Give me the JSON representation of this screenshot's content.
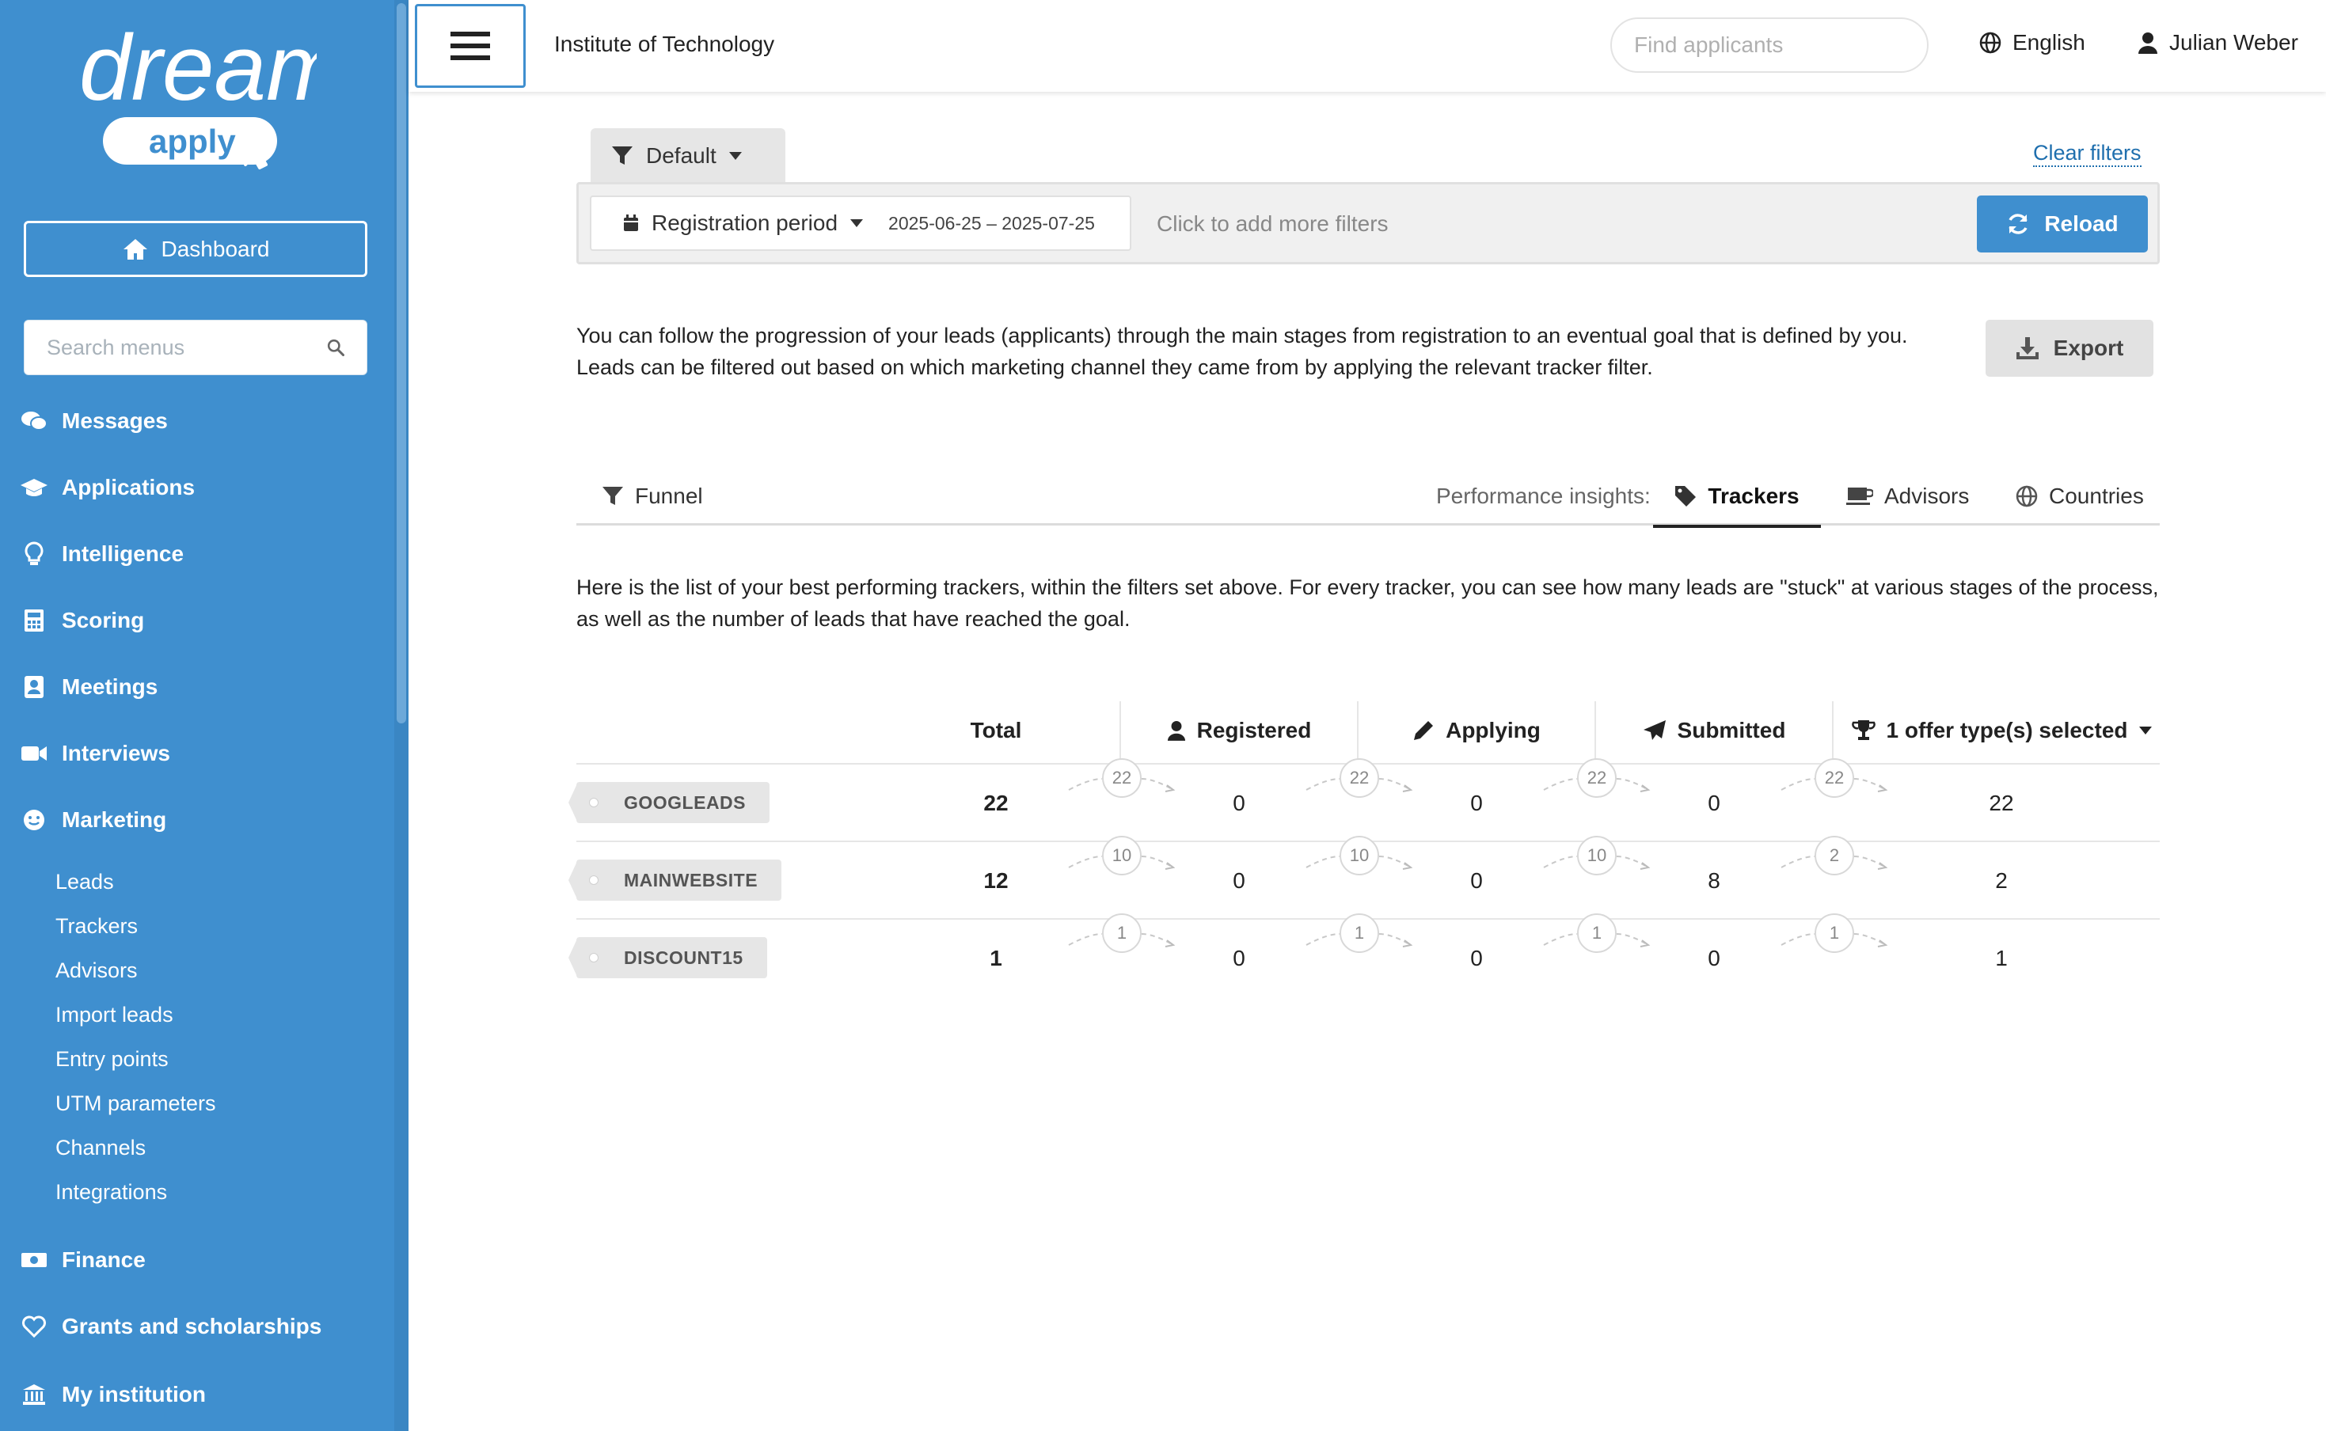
{
  "sidebar": {
    "logo_text": "dream",
    "logo_sub": "apply",
    "dashboard_label": "Dashboard",
    "search_placeholder": "Search menus",
    "items": [
      {
        "label": "Messages",
        "icon": "comments-icon"
      },
      {
        "label": "Applications",
        "icon": "graduation-cap-icon"
      },
      {
        "label": "Intelligence",
        "icon": "lightbulb-icon"
      },
      {
        "label": "Scoring",
        "icon": "calculator-icon"
      },
      {
        "label": "Meetings",
        "icon": "contact-card-icon"
      },
      {
        "label": "Interviews",
        "icon": "video-camera-icon"
      },
      {
        "label": "Marketing",
        "icon": "smile-icon"
      },
      {
        "label": "Finance",
        "icon": "money-icon"
      },
      {
        "label": "Grants and scholarships",
        "icon": "heart-icon"
      },
      {
        "label": "My institution",
        "icon": "institution-icon"
      }
    ],
    "marketing_sub": [
      "Leads",
      "Trackers",
      "Advisors",
      "Import leads",
      "Entry points",
      "UTM parameters",
      "Channels",
      "Integrations"
    ]
  },
  "topbar": {
    "institution": "Institute of Technology",
    "search_placeholder": "Find applicants",
    "language": "English",
    "user": "Julian Weber"
  },
  "filters": {
    "preset": "Default",
    "clear_label": "Clear filters",
    "period_label": "Registration period",
    "period_dates": "2025-06-25 – 2025-07-25",
    "add_more": "Click to add more filters",
    "reload_label": "Reload"
  },
  "intro": {
    "text": "You can follow the progression of your leads (applicants) through the main stages from registration to an eventual goal that is defined by you. Leads can be filtered out based on which marketing channel they came from by applying the relevant tracker filter.",
    "export_label": "Export"
  },
  "tabs": {
    "funnel": "Funnel",
    "perf_label": "Performance insights:",
    "trackers": "Trackers",
    "advisors": "Advisors",
    "countries": "Countries"
  },
  "description": "Here is the list of your best performing trackers, within the filters set above. For every tracker, you can see how many leads are \"stuck\" at various stages of the process, as well as the number of leads that have reached the goal.",
  "table": {
    "headers": {
      "total": "Total",
      "registered": "Registered",
      "applying": "Applying",
      "submitted": "Submitted",
      "goal": "1 offer type(s) selected"
    },
    "rows": [
      {
        "tracker": "GOOGLEADS",
        "total": "22",
        "flow1": "22",
        "registered": "0",
        "flow2": "22",
        "applying": "0",
        "flow3": "22",
        "submitted": "0",
        "flow4": "22",
        "goal": "22"
      },
      {
        "tracker": "MAINWEBSITE",
        "total": "12",
        "flow1": "10",
        "registered": "0",
        "flow2": "10",
        "applying": "0",
        "flow3": "10",
        "submitted": "8",
        "flow4": "2",
        "goal": "2"
      },
      {
        "tracker": "DISCOUNT15",
        "total": "1",
        "flow1": "1",
        "registered": "0",
        "flow2": "1",
        "applying": "0",
        "flow3": "1",
        "submitted": "0",
        "flow4": "1",
        "goal": "1"
      }
    ]
  },
  "colors": {
    "sidebar_bg": "#3f8fcf",
    "accent": "#3f8fcf",
    "link": "#1f6fae"
  }
}
